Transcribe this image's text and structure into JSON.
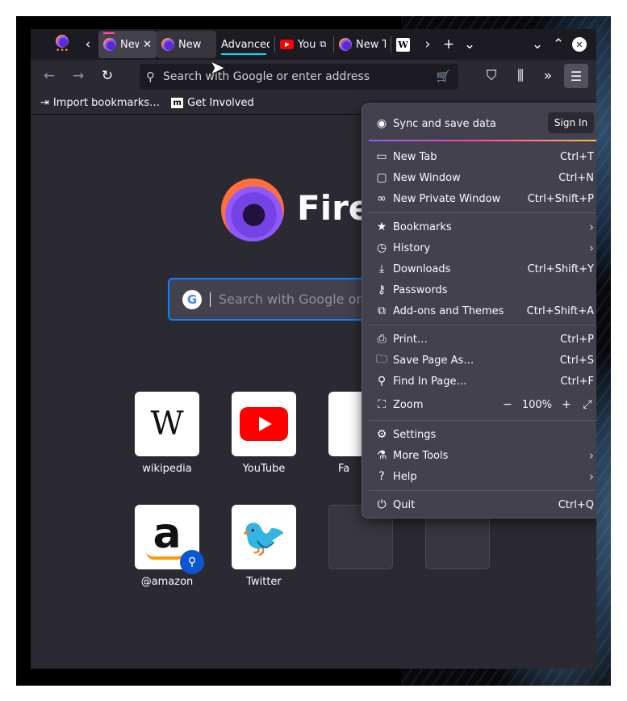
{
  "tabs": {
    "audio_tab_indicator": "•••",
    "items": [
      {
        "label": "New",
        "close": "✕"
      },
      {
        "label": "New"
      },
      {
        "label": "Advanced"
      },
      {
        "label": "You"
      },
      {
        "label": "New T"
      },
      {
        "label": "W"
      }
    ],
    "overflow": "»",
    "new_tab": "+",
    "list_all": "⌄",
    "win_min": "⌄",
    "win_max": "⌃",
    "win_close": "✕"
  },
  "nav": {
    "back": "←",
    "forward": "→",
    "reload": "↻",
    "url_placeholder": "Search with Google or enter address"
  },
  "bookmarks": [
    {
      "label": "Import bookmarks…"
    },
    {
      "label": "Get Involved"
    }
  ],
  "newtab": {
    "brand_partial": "Fire",
    "search_placeholder": "Search with Google or e",
    "google_letter": "G",
    "top_sites": [
      {
        "label": "wikipedia",
        "glyph": "W"
      },
      {
        "label": "YouTube"
      },
      {
        "label": "Fa"
      },
      {
        "label": "@amazon",
        "glyph": "a"
      },
      {
        "label": "Twitter",
        "glyph": "🐦"
      }
    ]
  },
  "app_menu": {
    "sync_label": "Sync and save data",
    "sign_in": "Sign In",
    "items_1": [
      {
        "label": "New Tab",
        "shortcut": "Ctrl+T",
        "icon": "new-tab-icon",
        "glyph": "▭"
      },
      {
        "label": "New Window",
        "shortcut": "Ctrl+N",
        "icon": "window-icon",
        "glyph": "▢"
      },
      {
        "label": "New Private Window",
        "shortcut": "Ctrl+Shift+P",
        "icon": "private-mask-icon",
        "glyph": "∞"
      }
    ],
    "items_2": [
      {
        "label": "Bookmarks",
        "glyph": "★"
      },
      {
        "label": "History",
        "glyph": "◷"
      },
      {
        "label": "Downloads",
        "shortcut": "Ctrl+Shift+Y",
        "glyph": "⤓"
      },
      {
        "label": "Passwords",
        "glyph": "⚷"
      },
      {
        "label": "Add-ons and Themes",
        "shortcut": "Ctrl+Shift+A",
        "glyph": "⧉"
      }
    ],
    "items_3": [
      {
        "label": "Print…",
        "shortcut": "Ctrl+P",
        "glyph": "⎙"
      },
      {
        "label": "Save Page As…",
        "shortcut": "Ctrl+S",
        "glyph": "🗀"
      },
      {
        "label": "Find In Page…",
        "shortcut": "Ctrl+F",
        "glyph": "⚲"
      }
    ],
    "zoom": {
      "label": "Zoom",
      "minus": "−",
      "value": "100%",
      "plus": "+",
      "fullscreen": "⤢"
    },
    "items_4": [
      {
        "label": "Settings",
        "glyph": "⚙"
      },
      {
        "label": "More Tools",
        "glyph": "⚗"
      },
      {
        "label": "Help",
        "glyph": "?"
      }
    ],
    "quit": {
      "label": "Quit",
      "shortcut": "Ctrl+Q",
      "glyph": "⏻"
    }
  }
}
